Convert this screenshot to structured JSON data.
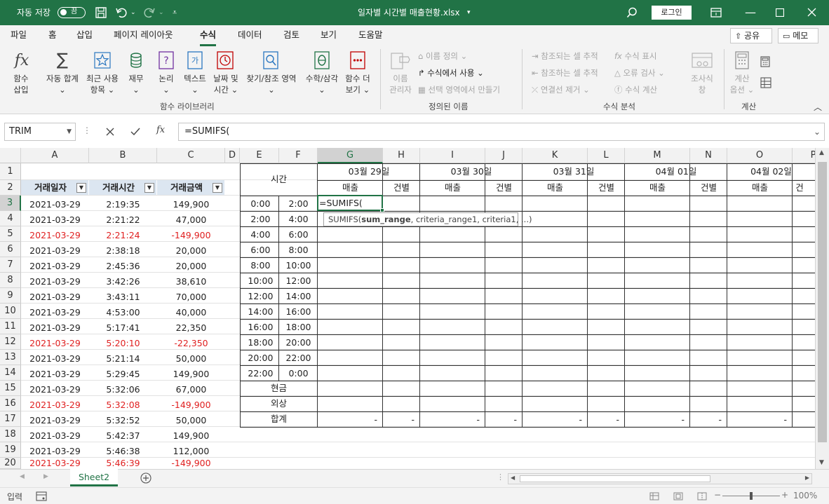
{
  "titlebar": {
    "autosave_label": "자동 저장",
    "autosave_state": "끔",
    "doc_title": "일자별 시간별 매출현황.xlsx",
    "login": "로그인"
  },
  "menu": {
    "items": [
      "파일",
      "홈",
      "삽입",
      "페이지 레이아웃",
      "수식",
      "데이터",
      "검토",
      "보기",
      "도움말"
    ],
    "active": "수식",
    "share": "공유",
    "memo": "메모"
  },
  "ribbon": {
    "insert_function": [
      "함수",
      "삽입"
    ],
    "autosum": [
      "자동 합계"
    ],
    "recent": [
      "최근 사용",
      "항목"
    ],
    "financial": [
      "재무"
    ],
    "logical": [
      "논리"
    ],
    "text": [
      "텍스트"
    ],
    "datetime": [
      "날짜 및",
      "시간"
    ],
    "lookup": [
      "찾기/참조",
      "영역"
    ],
    "math": [
      "수학/삼각"
    ],
    "more": [
      "함수 더",
      "보기"
    ],
    "group_library": "함수 라이브러리",
    "name_manager": [
      "이름",
      "관리자"
    ],
    "define_name": "이름 정의",
    "use_in_formula": "수식에서 사용",
    "create_from_selection": "선택 영역에서 만들기",
    "group_names": "정의된 이름",
    "trace_precedents": "참조되는 셀 추적",
    "trace_dependents": "참조하는 셀 추적",
    "remove_arrows": "연결선 제거",
    "show_formulas": "수식 표시",
    "error_checking": "오류 검사",
    "evaluate_formula": "수식 계산",
    "watch_window": [
      "조사식",
      "창"
    ],
    "group_audit": "수식 분석",
    "calc_options": [
      "계산",
      "옵션"
    ],
    "group_calc": "계산"
  },
  "formula_bar": {
    "name_box": "TRIM",
    "formula": "=SUMIFS("
  },
  "columns": [
    "A",
    "B",
    "C",
    "D",
    "E",
    "F",
    "G",
    "H",
    "I",
    "J",
    "K",
    "L",
    "M",
    "N",
    "O",
    "P"
  ],
  "selected_column": "G",
  "rows": [
    "1",
    "2",
    "3",
    "4",
    "5",
    "6",
    "7",
    "8",
    "9",
    "10",
    "11",
    "12",
    "13",
    "14",
    "15",
    "16",
    "17",
    "18",
    "19",
    "20"
  ],
  "selected_row": "3",
  "table_headers": [
    "거래일자",
    "거래시간",
    "거래금액"
  ],
  "transactions": [
    {
      "date": "2021-03-29",
      "time": "2:19:35",
      "amount": "149,900",
      "negative": false
    },
    {
      "date": "2021-03-29",
      "time": "2:21:22",
      "amount": "47,000",
      "negative": false
    },
    {
      "date": "2021-03-29",
      "time": "2:21:24",
      "amount": "-149,900",
      "negative": true
    },
    {
      "date": "2021-03-29",
      "time": "2:38:18",
      "amount": "20,000",
      "negative": false
    },
    {
      "date": "2021-03-29",
      "time": "2:45:36",
      "amount": "20,000",
      "negative": false
    },
    {
      "date": "2021-03-29",
      "time": "3:42:26",
      "amount": "38,610",
      "negative": false
    },
    {
      "date": "2021-03-29",
      "time": "3:43:11",
      "amount": "70,000",
      "negative": false
    },
    {
      "date": "2021-03-29",
      "time": "4:53:00",
      "amount": "40,000",
      "negative": false
    },
    {
      "date": "2021-03-29",
      "time": "5:17:41",
      "amount": "22,350",
      "negative": false
    },
    {
      "date": "2021-03-29",
      "time": "5:20:10",
      "amount": "-22,350",
      "negative": true
    },
    {
      "date": "2021-03-29",
      "time": "5:21:14",
      "amount": "50,000",
      "negative": false
    },
    {
      "date": "2021-03-29",
      "time": "5:29:45",
      "amount": "149,900",
      "negative": false
    },
    {
      "date": "2021-03-29",
      "time": "5:32:06",
      "amount": "67,000",
      "negative": false
    },
    {
      "date": "2021-03-29",
      "time": "5:32:08",
      "amount": "-149,900",
      "negative": true
    },
    {
      "date": "2021-03-29",
      "time": "5:32:52",
      "amount": "50,000",
      "negative": false
    },
    {
      "date": "2021-03-29",
      "time": "5:42:37",
      "amount": "149,900",
      "negative": false
    },
    {
      "date": "2021-03-29",
      "time": "5:46:38",
      "amount": "112,000",
      "negative": false
    },
    {
      "date": "2021-03-29",
      "time": "5:46:39",
      "amount": "-149,900",
      "negative": true
    }
  ],
  "summary": {
    "time_header": "시간",
    "dates": [
      "03월 29일",
      "03월 30일",
      "03월 31일",
      "04월 01일",
      "04월 02일"
    ],
    "sales_label": "매출",
    "count_label": "건별",
    "count_label_cut": "건",
    "slots": [
      [
        "0:00",
        "2:00"
      ],
      [
        "2:00",
        "4:00"
      ],
      [
        "4:00",
        "6:00"
      ],
      [
        "6:00",
        "8:00"
      ],
      [
        "8:00",
        "10:00"
      ],
      [
        "10:00",
        "12:00"
      ],
      [
        "12:00",
        "14:00"
      ],
      [
        "14:00",
        "16:00"
      ],
      [
        "16:00",
        "18:00"
      ],
      [
        "18:00",
        "20:00"
      ],
      [
        "20:00",
        "22:00"
      ],
      [
        "22:00",
        "0:00"
      ]
    ],
    "cash": "현금",
    "credit": "외상",
    "total": "합계",
    "dash": "-",
    "active_entry": "=SUMIFS("
  },
  "tooltip": {
    "fn": "SUMIFS(",
    "bold_arg": "sum_range",
    "rest": ", criteria_range1, criteria1, ...)"
  },
  "sheet_tab": "Sheet2",
  "status": {
    "mode": "입력",
    "zoom": "100%"
  }
}
